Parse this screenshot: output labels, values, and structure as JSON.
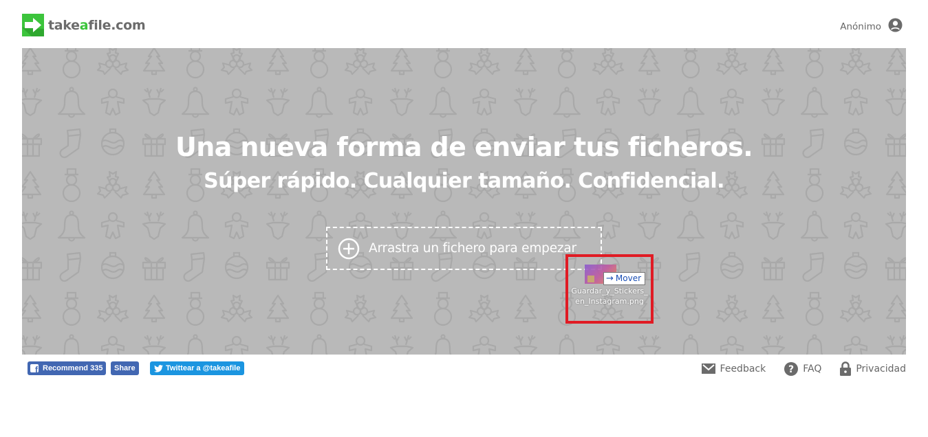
{
  "header": {
    "logo": {
      "prefix": "take",
      "accent": "a",
      "suffix": "file.com"
    },
    "user": {
      "name": "Anónimo",
      "icon": "user-circle-icon"
    }
  },
  "hero": {
    "title": "Una nueva forma de enviar tus ficheros.",
    "subtitle": "Súper rápido. Cualquier tamaño. Confidencial.",
    "dropzone": {
      "label": "Arrastra un fichero para empezar",
      "icon": "plus-circle-icon"
    },
    "pattern_icons": [
      "tree",
      "snowman",
      "holly",
      "deer",
      "bell",
      "gingerbread",
      "gift",
      "stocking",
      "ornament"
    ]
  },
  "drag": {
    "tooltip": "Mover",
    "tooltip_icon": "arrow-right-icon",
    "filename": "Guardar_y_Stickers_en_Instagram.png"
  },
  "footer": {
    "facebook": {
      "recommend_label": "Recommend",
      "count": "335",
      "share_label": "Share"
    },
    "twitter": {
      "label": "Twittear a @takeafile"
    },
    "links": [
      {
        "label": "Feedback",
        "icon": "mail-icon"
      },
      {
        "label": "FAQ",
        "icon": "question-circle-icon"
      },
      {
        "label": "Privacidad",
        "icon": "lock-icon"
      }
    ]
  },
  "colors": {
    "brand_green": "#3cc43c",
    "hero_bg": "#b9b9b9",
    "pattern_stroke": "#a9a9a9",
    "text_gray": "#666666",
    "facebook_blue": "#4267b2",
    "twitter_blue": "#1b95e0",
    "highlight_red": "#e01b24"
  }
}
